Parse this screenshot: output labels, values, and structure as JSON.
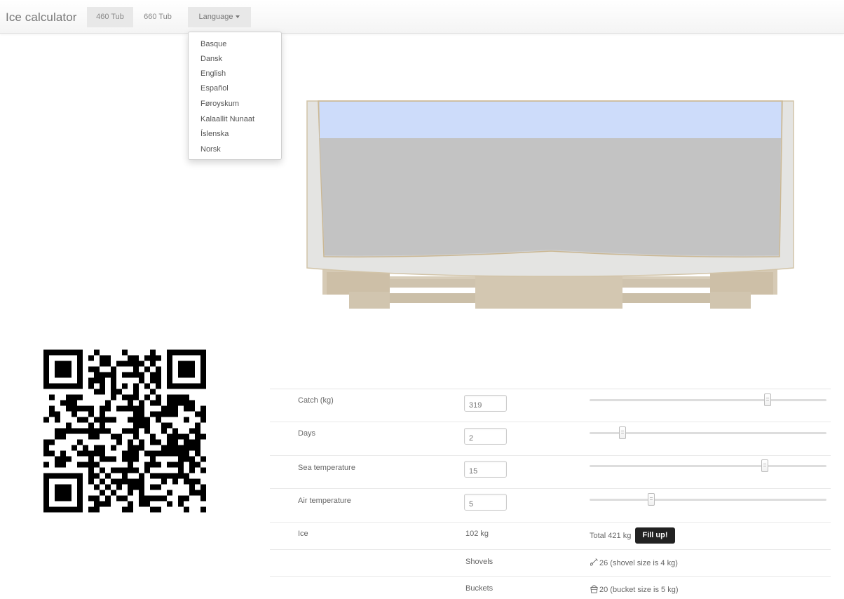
{
  "navbar": {
    "brand": "Ice calculator",
    "tabs": [
      {
        "label": "460 Tub",
        "active": true
      },
      {
        "label": "660 Tub",
        "active": false
      }
    ],
    "language_label": "Language"
  },
  "language_menu": {
    "items": [
      "Basque",
      "Dansk",
      "English",
      "Español",
      "Føroyskum",
      "Kalaallit Nunaat",
      "Íslenska",
      "Norsk"
    ]
  },
  "tub_illustration": {
    "ice_level": 0.2,
    "colors": {
      "frame": "#e3e3e1",
      "outline": "#c9b99a",
      "ice": "#cddcfa",
      "catch": "#c3c3c3",
      "pallet": "#d4c9b6"
    }
  },
  "calculator": {
    "rows": [
      {
        "label": "Catch (kg)",
        "value": "319",
        "slider_fraction": 0.75
      },
      {
        "label": "Days",
        "value": "2",
        "slider_fraction": 0.14
      },
      {
        "label": "Sea temperature",
        "value": "15",
        "slider_fraction": 0.74
      },
      {
        "label": "Air temperature",
        "value": "5",
        "slider_fraction": 0.26
      }
    ],
    "ice": {
      "label": "Ice",
      "amount": "102 kg",
      "total": "Total 421 kg",
      "fill_button": "Fill up!"
    },
    "shovels": {
      "label": "Shovels",
      "text": "26 (shovel size is 4 kg)",
      "icon": "shovel-icon"
    },
    "buckets": {
      "label": "Buckets",
      "text": "20 (bucket size is 5 kg)",
      "icon": "bucket-icon"
    }
  }
}
